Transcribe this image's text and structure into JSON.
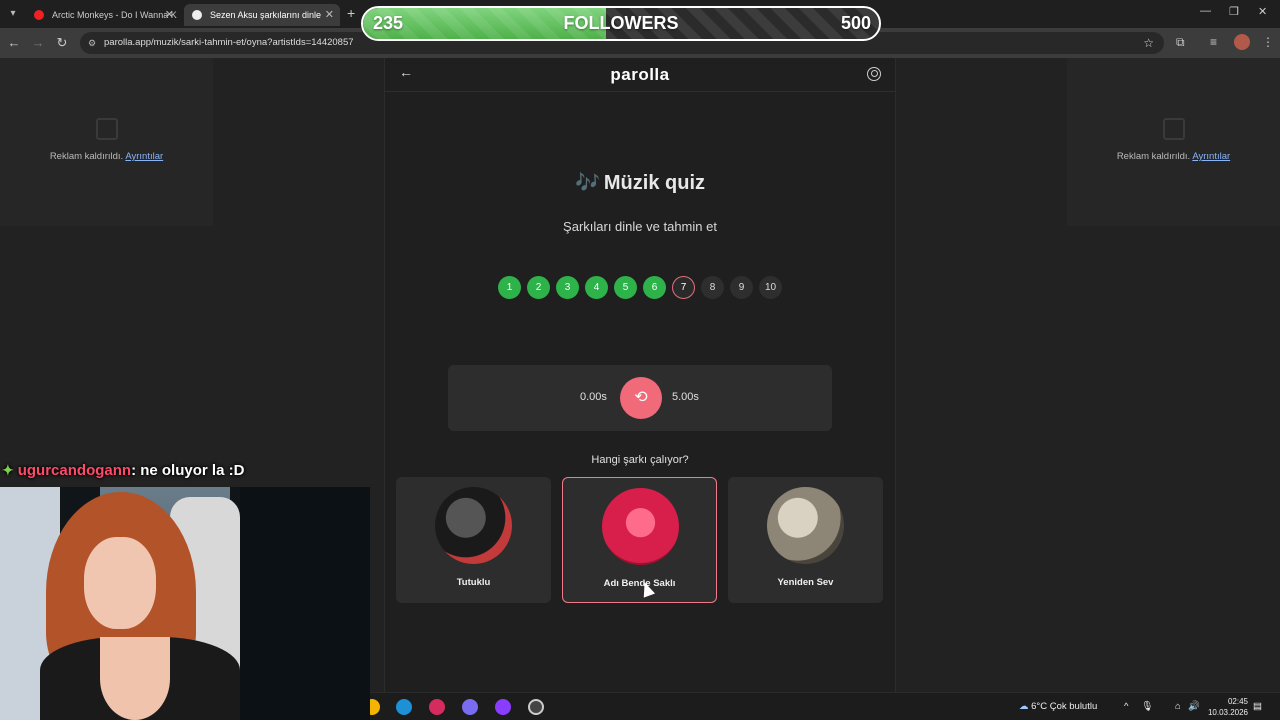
{
  "tabs": [
    {
      "title": "Arctic Monkeys - Do I Wanna K",
      "active": false
    },
    {
      "title": "Sezen Aksu şarkılarını dinle",
      "active": true
    }
  ],
  "address_bar": {
    "url": "parolla.app/muzik/sarki-tahmin-et/oyna?artistIds=14420857"
  },
  "follower_goal": {
    "current": "235",
    "label": "FOLLOWERS",
    "target": "500",
    "progress": 0.47
  },
  "ads": {
    "removed_text": "Reklam kaldırıldı.",
    "details_link": "Ayrıntılar"
  },
  "app": {
    "brand": "parolla",
    "title_icon": "music-note",
    "title": "Müzik quiz",
    "subtitle": "Şarkıları dinle ve tahmin et",
    "steps": [
      {
        "label": "1",
        "state": "done"
      },
      {
        "label": "2",
        "state": "done"
      },
      {
        "label": "3",
        "state": "done"
      },
      {
        "label": "4",
        "state": "done"
      },
      {
        "label": "5",
        "state": "done"
      },
      {
        "label": "6",
        "state": "done"
      },
      {
        "label": "7",
        "state": "current"
      },
      {
        "label": "8",
        "state": "todo"
      },
      {
        "label": "9",
        "state": "todo"
      },
      {
        "label": "10",
        "state": "todo"
      }
    ],
    "player": {
      "start_time": "0.00s",
      "end_time": "5.00s"
    },
    "question": "Hangi şarkı çalıyor?",
    "options": [
      {
        "label": "Tutuklu",
        "selected": false
      },
      {
        "label": "Adı Bende Saklı",
        "selected": true
      },
      {
        "label": "Yeniden Sev",
        "selected": false
      }
    ],
    "colors": {
      "done": "#2db34a",
      "accent": "#f06a7a"
    }
  },
  "chat": {
    "username": "ugurcandogann",
    "message": ": ne oluyor la :D"
  },
  "taskbar": {
    "weather": "6°C  Çok bulutlu",
    "time": "02:45",
    "date": "10.03.2026"
  }
}
